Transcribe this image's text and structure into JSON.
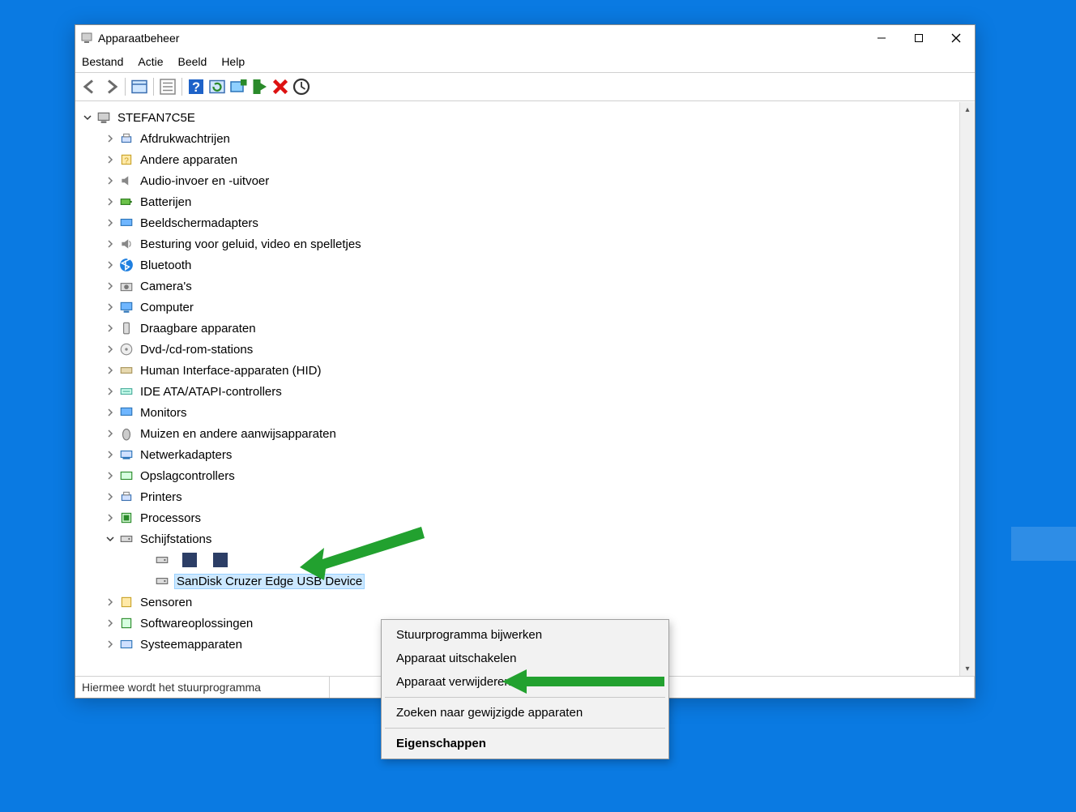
{
  "window": {
    "title": "Apparaatbeheer"
  },
  "window_controls": {
    "min_symbol": "−",
    "max_symbol": "□",
    "close_symbol": "✕"
  },
  "menu": {
    "file": "Bestand",
    "action": "Actie",
    "view": "Beeld",
    "help": "Help"
  },
  "toolbar_icons": {
    "back": "back-icon",
    "forward": "forward-icon",
    "show_hidden": "show-hidden-icon",
    "properties": "properties-icon",
    "help": "help-icon",
    "refresh": "refresh-icon",
    "update_driver": "update-driver-icon",
    "uninstall": "uninstall-icon",
    "delete": "delete-icon",
    "scan": "scan-icon"
  },
  "tree": {
    "root": "STEFAN7C5E",
    "items": [
      {
        "label": "Afdrukwachtrijen",
        "icon": "printer-queue-icon"
      },
      {
        "label": "Andere apparaten",
        "icon": "other-devices-icon"
      },
      {
        "label": "Audio-invoer en -uitvoer",
        "icon": "audio-icon"
      },
      {
        "label": "Batterijen",
        "icon": "battery-icon"
      },
      {
        "label": "Beeldschermadapters",
        "icon": "display-adapter-icon"
      },
      {
        "label": "Besturing voor geluid, video en spelletjes",
        "icon": "sound-controller-icon"
      },
      {
        "label": "Bluetooth",
        "icon": "bluetooth-icon"
      },
      {
        "label": "Camera's",
        "icon": "camera-icon"
      },
      {
        "label": "Computer",
        "icon": "computer-icon"
      },
      {
        "label": "Draagbare apparaten",
        "icon": "portable-device-icon"
      },
      {
        "label": "Dvd-/cd-rom-stations",
        "icon": "optical-drive-icon"
      },
      {
        "label": "Human Interface-apparaten (HID)",
        "icon": "hid-icon"
      },
      {
        "label": "IDE ATA/ATAPI-controllers",
        "icon": "ide-controller-icon"
      },
      {
        "label": "Monitors",
        "icon": "monitor-icon"
      },
      {
        "label": "Muizen en andere aanwijsapparaten",
        "icon": "mouse-icon"
      },
      {
        "label": "Netwerkadapters",
        "icon": "network-adapter-icon"
      },
      {
        "label": "Opslagcontrollers",
        "icon": "storage-controller-icon"
      },
      {
        "label": "Printers",
        "icon": "printers-icon"
      },
      {
        "label": "Processors",
        "icon": "processor-icon"
      }
    ],
    "disk_drives": {
      "label": "Schijfstations",
      "children": [
        {
          "label": "",
          "icon": "disk-icon",
          "redacted": true
        },
        {
          "label": "SanDisk Cruzer Edge USB Device",
          "icon": "disk-icon",
          "selected": true
        }
      ]
    },
    "after": [
      {
        "label": "Sensoren",
        "icon": "sensor-icon"
      },
      {
        "label": "Softwareoplossingen",
        "icon": "software-component-icon"
      },
      {
        "label": "Systeemapparaten",
        "icon": "system-device-icon"
      }
    ]
  },
  "context_menu": {
    "update": "Stuurprogramma bijwerken",
    "disable": "Apparaat uitschakelen",
    "remove": "Apparaat verwijderen",
    "scan": "Zoeken naar gewijzigde apparaten",
    "properties": "Eigenschappen"
  },
  "statusbar": {
    "text": "Hiermee wordt het stuurprogramma"
  },
  "annotation_arrows": {
    "arrow1_target": "Schijfstations",
    "arrow2_target": "Apparaat verwijderen",
    "color": "#22a12f"
  }
}
